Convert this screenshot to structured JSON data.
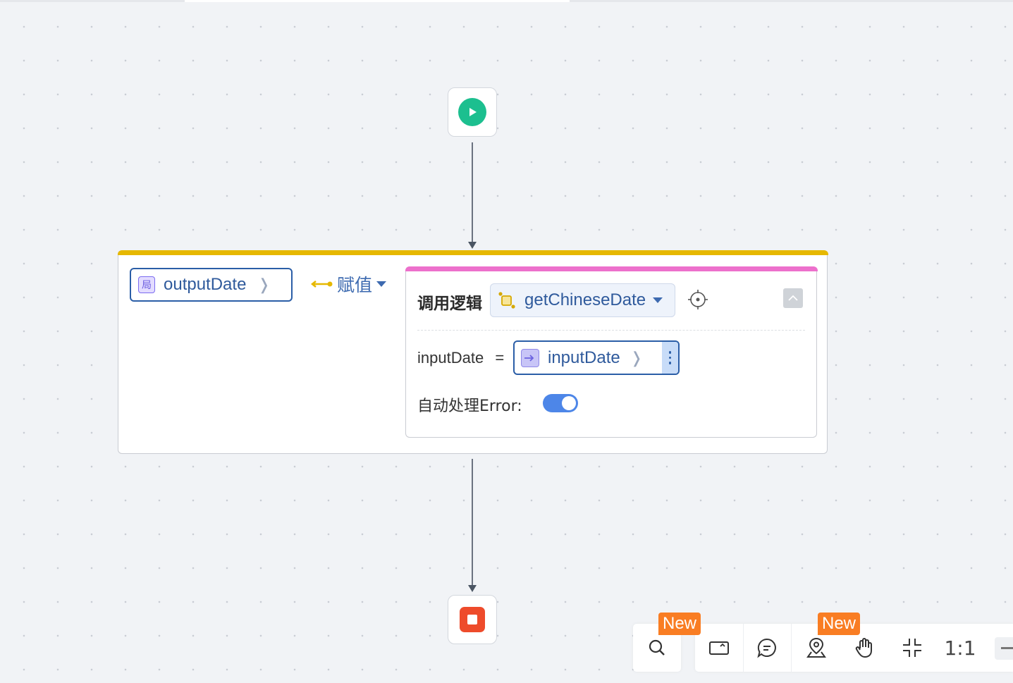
{
  "canvas": {
    "background": "#f1f3f6",
    "start_node": {
      "icon": "play-icon",
      "color": "#1cbf8f"
    },
    "end_node": {
      "icon": "stop-icon",
      "color": "#ee4b2b"
    }
  },
  "assign_block": {
    "accent_color": "#e6b800",
    "target_variable": {
      "badge": "局",
      "name": "outputDate"
    },
    "operator": {
      "label": "赋值"
    },
    "call_logic": {
      "accent_color": "#ed70cc",
      "title": "调用逻辑",
      "logic_name": "getChineseDate",
      "params": [
        {
          "label": "inputDate",
          "equals": "=",
          "value": "inputDate"
        }
      ],
      "auto_error": {
        "label": "自动处理Error:",
        "enabled": true
      }
    }
  },
  "toolbar": {
    "new_badge": "New",
    "ratio_label": "1:1",
    "tools": [
      "search-icon",
      "minimap-icon",
      "comment-icon",
      "locate-pin-icon",
      "hand-icon",
      "fit-view-icon",
      "zoom-ratio",
      "zoom-out-icon"
    ]
  }
}
